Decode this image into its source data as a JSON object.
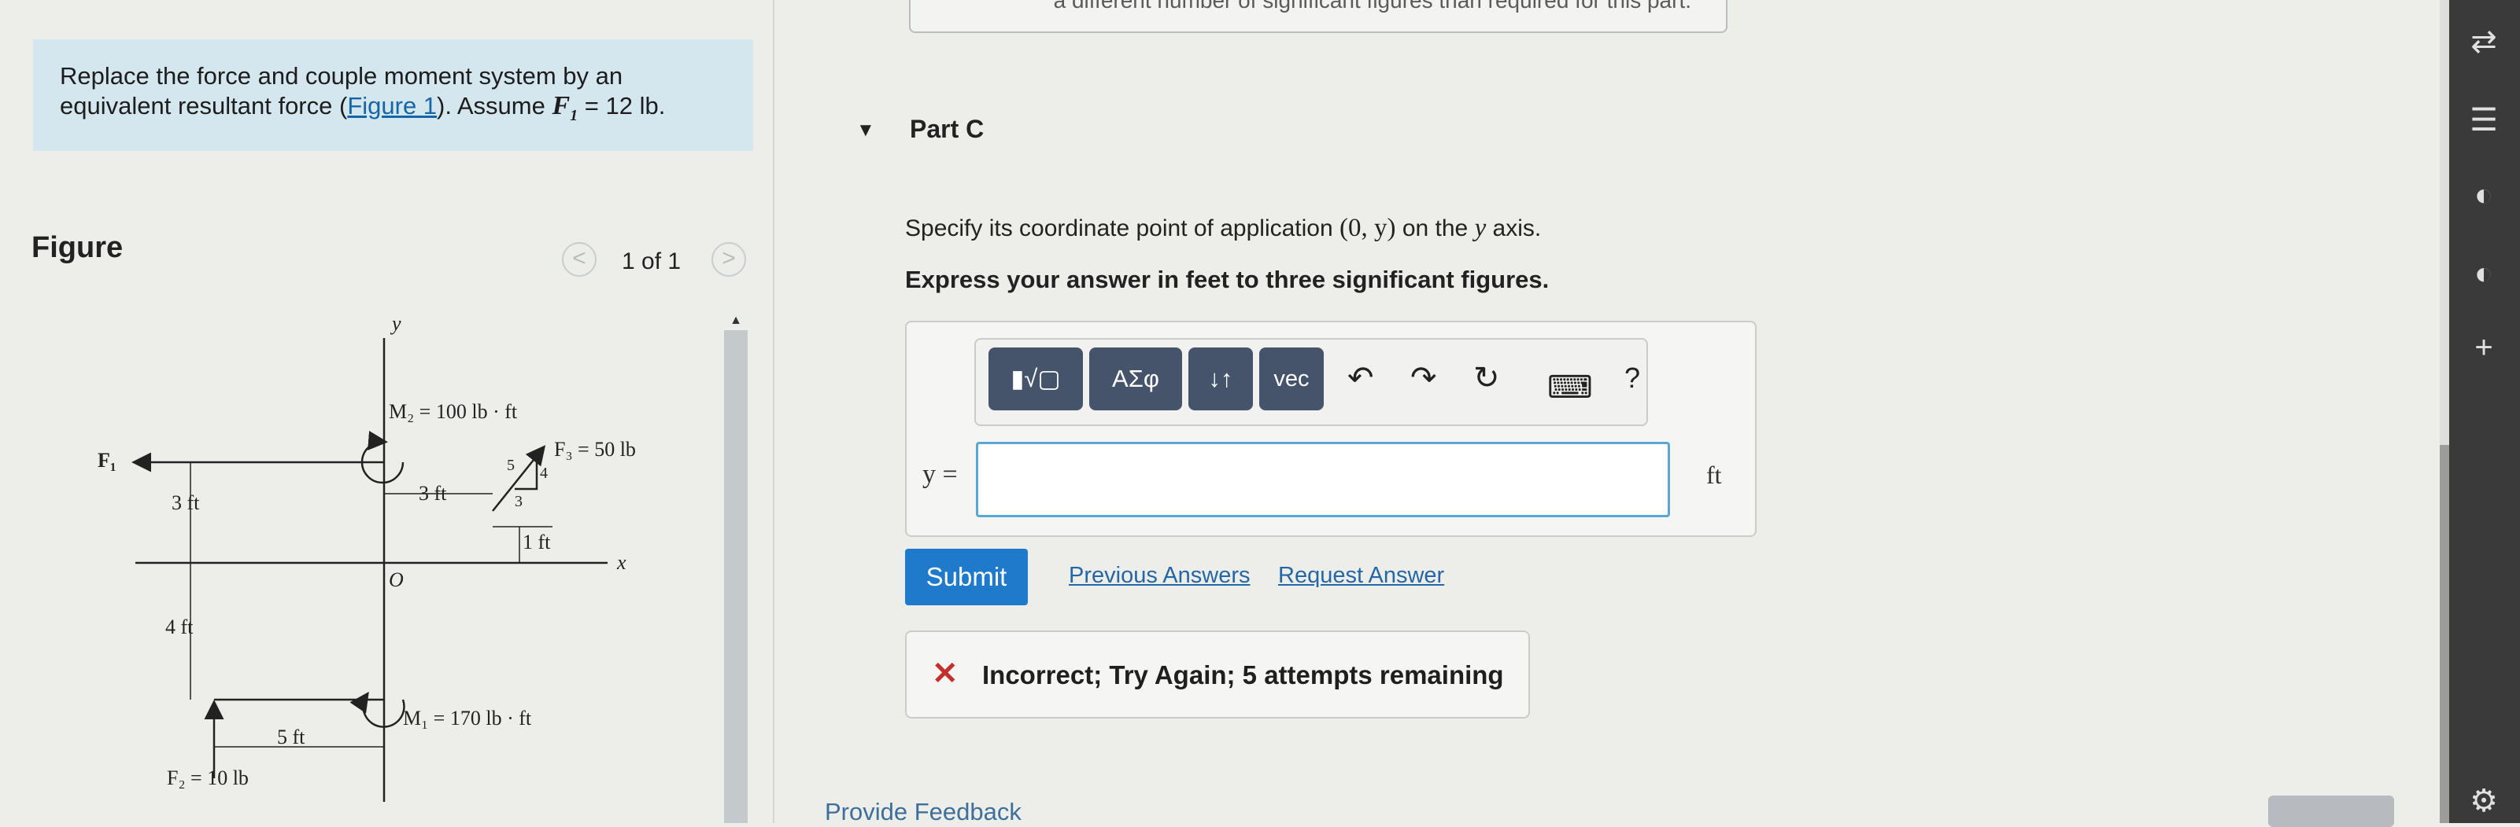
{
  "problem": {
    "line1": "Replace the force and couple moment system by an",
    "line2_pre": "equivalent resultant force (",
    "figure_link": "Figure 1",
    "line2_mid": "). Assume ",
    "var": "F",
    "var_sub": "1",
    "line2_post": " = 12 lb."
  },
  "figure": {
    "title": "Figure",
    "prev_icon": "<",
    "next_icon": ">",
    "counter": "1 of 1",
    "scroll_up_icon": "▲",
    "labels": {
      "y_axis": "y",
      "x_axis": "x",
      "origin": "O",
      "m2": "M₂ = 100 lb · ft",
      "f3": "F₃ = 50 lb",
      "f1": "F₁",
      "tri_5": "5",
      "tri_4": "4",
      "tri_3": "3",
      "dim_3ft_left": "3 ft",
      "dim_3ft_mid": "3 ft",
      "dim_1ft": "1 ft",
      "dim_4ft": "4 ft",
      "dim_5ft": "5 ft",
      "m1": "M₁ = 170 lb · ft",
      "f2": "F₂ = 10 lb"
    }
  },
  "top_hint": "a different number of significant figures than required for this part.",
  "part": {
    "caret": "▼",
    "title": "Part C",
    "instruction_pre": "Specify its coordinate point of application ",
    "instruction_math": "(0, y)",
    "instruction_mid": " on the ",
    "instruction_var": "y",
    "instruction_post": " axis.",
    "express": "Express your answer in feet to three significant figures."
  },
  "toolbar": {
    "templates": "▮√▢",
    "greek": "ΑΣφ",
    "arrows": "↓↑",
    "vec": "vec",
    "undo": "↶",
    "redo": "↷",
    "reset": "↻",
    "keyboard": "⌨",
    "help": "?"
  },
  "answer": {
    "label": "y =",
    "value": "",
    "unit": "ft"
  },
  "actions": {
    "submit": "Submit",
    "previous_answers": "Previous Answers",
    "request_answer": "Request Answer"
  },
  "feedback": {
    "icon": "✕",
    "message": "Incorrect; Try Again; 5 attempts remaining"
  },
  "footer": {
    "provide_feedback": "Provide Feedback"
  },
  "side": {
    "icons": [
      "⇄",
      "☰",
      "◐",
      "◐",
      "+",
      "⚙"
    ]
  }
}
